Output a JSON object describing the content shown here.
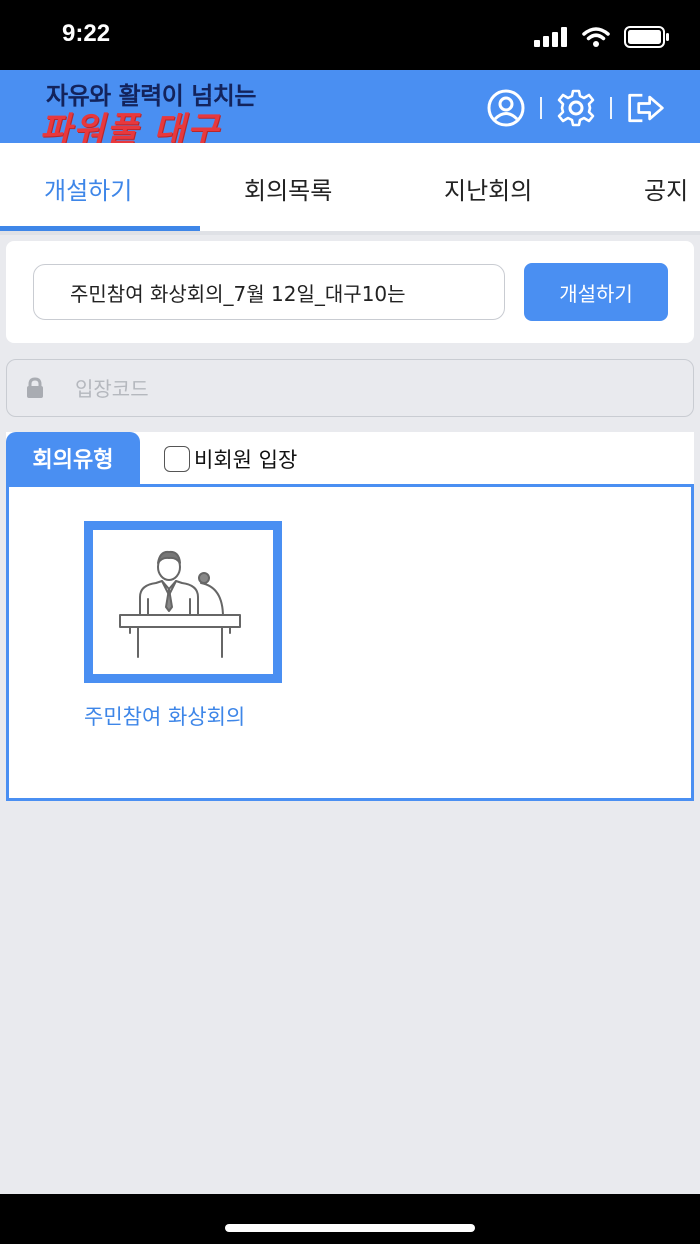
{
  "status_bar": {
    "time": "9:22",
    "icons": [
      "signal-icon",
      "wifi-icon",
      "battery-icon"
    ]
  },
  "header": {
    "logo_line1": "자유와 활력이 넘치는",
    "logo_line2": "파워풀 대구",
    "icons": [
      "user-icon",
      "gear-icon",
      "logout-icon"
    ],
    "colors": {
      "bar": "#4a8ff2",
      "logo_dark": "#13235c",
      "logo_red": "#e8383d"
    }
  },
  "tabs": [
    {
      "label": "개설하기",
      "active": true
    },
    {
      "label": "회의목록",
      "active": false
    },
    {
      "label": "지난회의",
      "active": false
    },
    {
      "label": "공지",
      "active": false
    }
  ],
  "create": {
    "title_value": "주민참여 화상회의_7월 12일_대구10는",
    "button_label": "개설하기"
  },
  "entry_code": {
    "placeholder": "입장코드",
    "icon": "lock-icon"
  },
  "meeting_type": {
    "tab_label": "회의유형",
    "guest_checkbox_label": "비회원 입장",
    "guest_checked": false,
    "items": [
      {
        "label": "주민참여 화상회의",
        "icon": "speaker-podium-icon",
        "selected": true
      }
    ]
  }
}
